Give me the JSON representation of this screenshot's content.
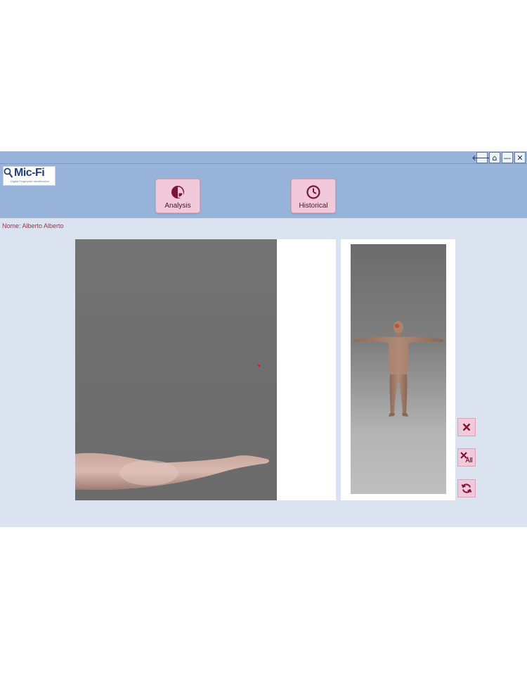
{
  "app": {
    "logo_text": "Mic-Fi",
    "logo_subtitle": "Digital Fingerprint Identification"
  },
  "window_controls": [
    {
      "name": "back-button",
      "glyph": "🡐"
    },
    {
      "name": "home-button",
      "glyph": "⌂"
    },
    {
      "name": "minimize-button",
      "glyph": "—"
    },
    {
      "name": "close-button",
      "glyph": "✕"
    }
  ],
  "nav": {
    "analysis": {
      "label": "Analysis",
      "icon": "pie-chart-icon"
    },
    "historical": {
      "label": "Historical",
      "icon": "clock-icon"
    }
  },
  "user": {
    "name_label": "Nome: Alberto Alberto"
  },
  "tools": [
    {
      "name": "delete-point-button",
      "icon": "x-icon"
    },
    {
      "name": "delete-all-button",
      "icon": "x-all-icon"
    },
    {
      "name": "refresh-button",
      "icon": "refresh-icon"
    }
  ],
  "colors": {
    "accent": "#7a1537",
    "header": "#98b3d9",
    "button": "#f2c9d8",
    "background": "#dbe3f0"
  }
}
